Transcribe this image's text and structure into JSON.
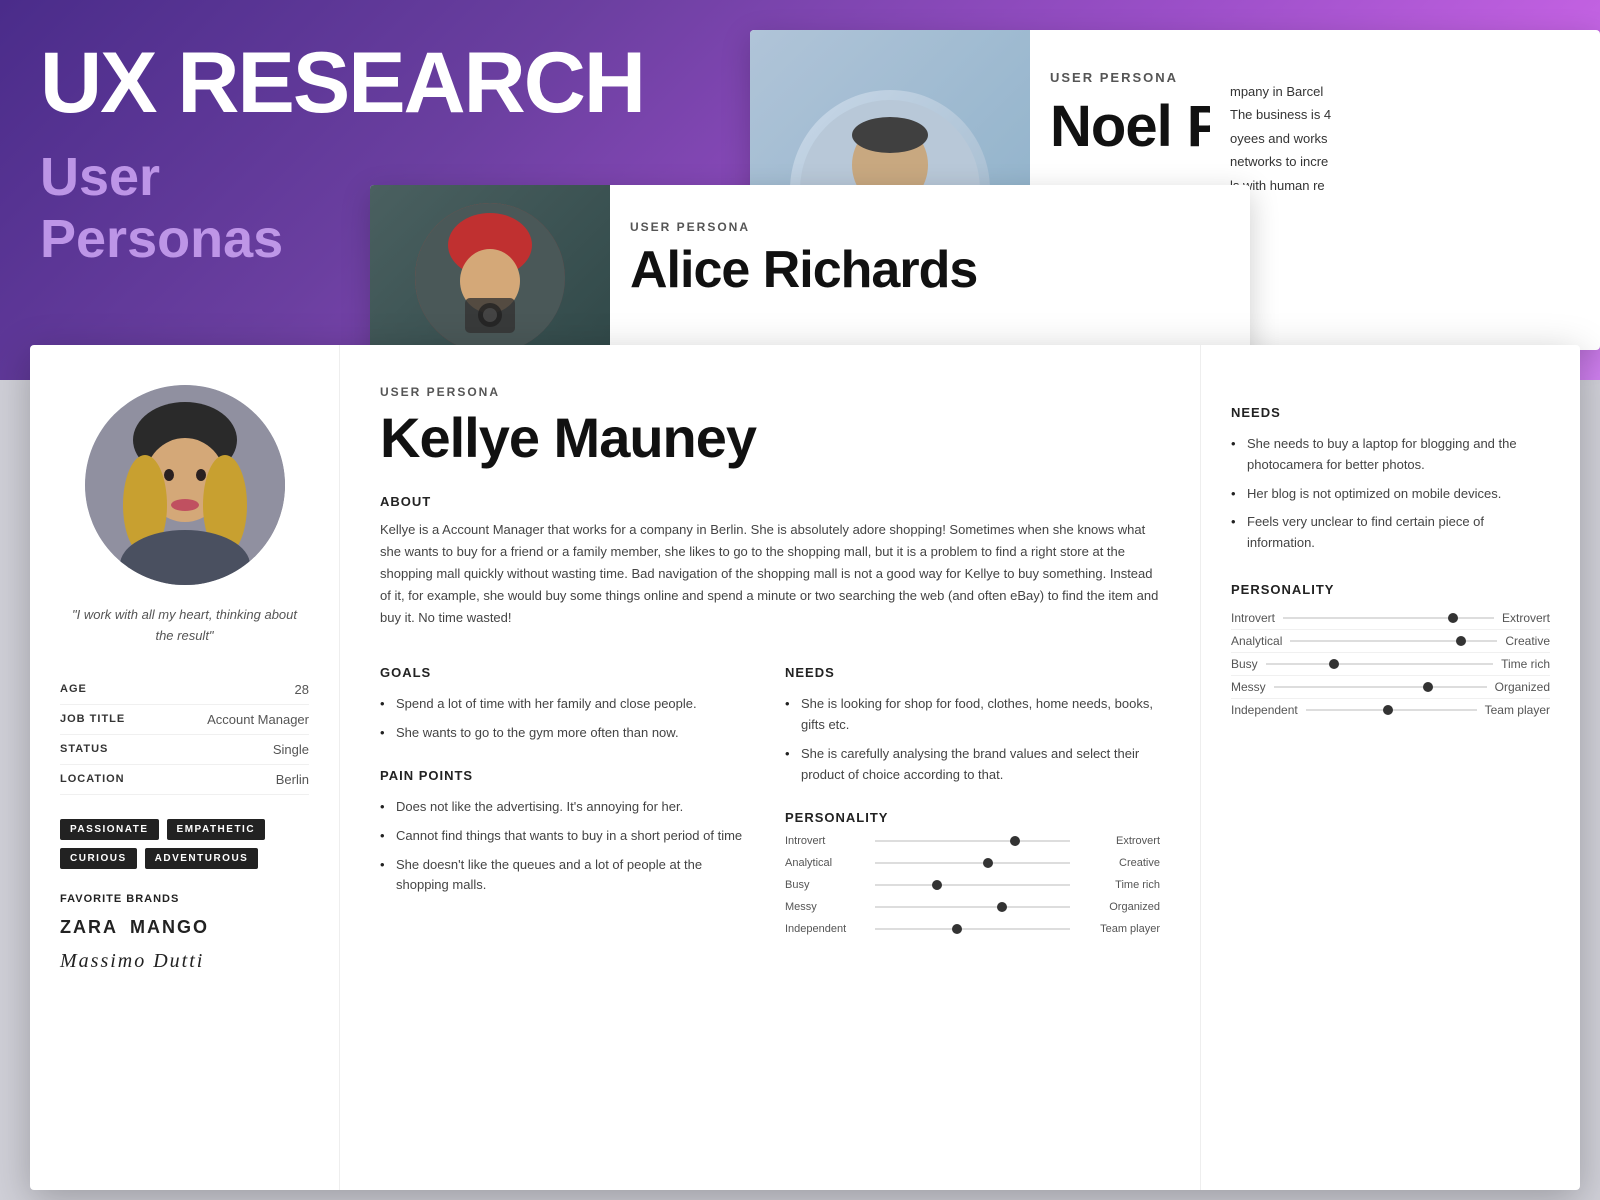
{
  "background": {
    "gradient_from": "#4a2c8a",
    "gradient_to": "#d080f0"
  },
  "header": {
    "title": "UX RESEARCH",
    "subtitle_line1": "User",
    "subtitle_line2": "Personas"
  },
  "card_noel": {
    "persona_label": "USER PERSONA",
    "name": "Noel Parrish",
    "partial_text_line1": "mpany in Barcel",
    "partial_text_line2": "The business is 4",
    "partial_text_line3": "oyees and works",
    "partial_text_line4": "networks to incre",
    "partial_text_line5": "ls with human re"
  },
  "card_alice": {
    "persona_label": "USER PERSONA",
    "name": "Alice Richards"
  },
  "card_kellye": {
    "persona_label": "USER PERSONA",
    "name": "Kellye Mauney",
    "photo_alt": "Kellye Mauney photo",
    "quote": "\"I work with all my heart, thinking about the result\"",
    "stats": {
      "age_label": "AGE",
      "age_value": "28",
      "job_label": "JOB TITLE",
      "job_value": "Account Manager",
      "status_label": "STATUS",
      "status_value": "Single",
      "location_label": "LOCATION",
      "location_value": "Berlin"
    },
    "tags": [
      "PASSIONATE",
      "EMPATHETIC",
      "CURIOUS",
      "ADVENTUROUS"
    ],
    "brands_title": "FAVORITE BRANDS",
    "brands": [
      "ZARA",
      "MANGO",
      "Massimo Dutti"
    ],
    "about_title": "ABOUT",
    "about_text": "Kellye is a Account Manager that works for a company in Berlin. She is absolutely adore shopping! Sometimes when she knows what she wants to buy for a friend or a family member, she likes to go to the shopping mall, but it is a problem to find a right store at the shopping mall quickly without wasting time. Bad navigation of the shopping mall is not a good way for Kellye to buy something. Instead of it, for example, she would buy some things online and spend a minute or two searching the web (and often eBay) to find the item and buy it. No time wasted!",
    "goals_title": "GOALS",
    "goals": [
      "Spend a lot of time with her family and close people.",
      "She wants to go to the gym more often than now."
    ],
    "needs_main_title": "NEEDS",
    "needs_main": [
      "She is looking for shop for food, clothes, home needs, books, gifts etc.",
      "She is carefully analysing the brand values and select their product of choice according to that."
    ],
    "pain_points_title": "PAIN POINTS",
    "pain_points": [
      "Does not like the advertising. It's annoying for her.",
      "Cannot find things that wants to buy in a short period of time",
      "She doesn't like the queues and a lot of people at the shopping malls."
    ],
    "personality_main_title": "PERSONALITY",
    "personality_sliders_main": [
      {
        "left": "Introvert",
        "right": "Extrovert",
        "position": 72
      },
      {
        "left": "Analytical",
        "right": "Creative",
        "position": 58
      },
      {
        "left": "Busy",
        "right": "Time rich",
        "position": 32
      },
      {
        "left": "Messy",
        "right": "Organized",
        "position": 65
      },
      {
        "left": "Independent",
        "right": "Team player",
        "position": 42
      }
    ],
    "right_panel_needs_title": "NEEDS",
    "right_panel_needs": [
      "She needs to buy a laptop for blogging and the photocamera for better photos.",
      "Her blog is not optimized on mobile devices.",
      "Feels very unclear to find certain piece of information."
    ],
    "right_panel_personality_title": "PERSONALITY",
    "right_panel_sliders": [
      {
        "left": "Introvert",
        "right": "Extrovert",
        "position": 78
      },
      {
        "left": "Analytical",
        "right": "Creative",
        "position": 80
      },
      {
        "left": "Busy",
        "right": "Time rich",
        "position": 28
      },
      {
        "left": "Messy",
        "right": "Organized",
        "position": 70
      },
      {
        "left": "Independent",
        "right": "Team player",
        "position": 45
      }
    ]
  }
}
